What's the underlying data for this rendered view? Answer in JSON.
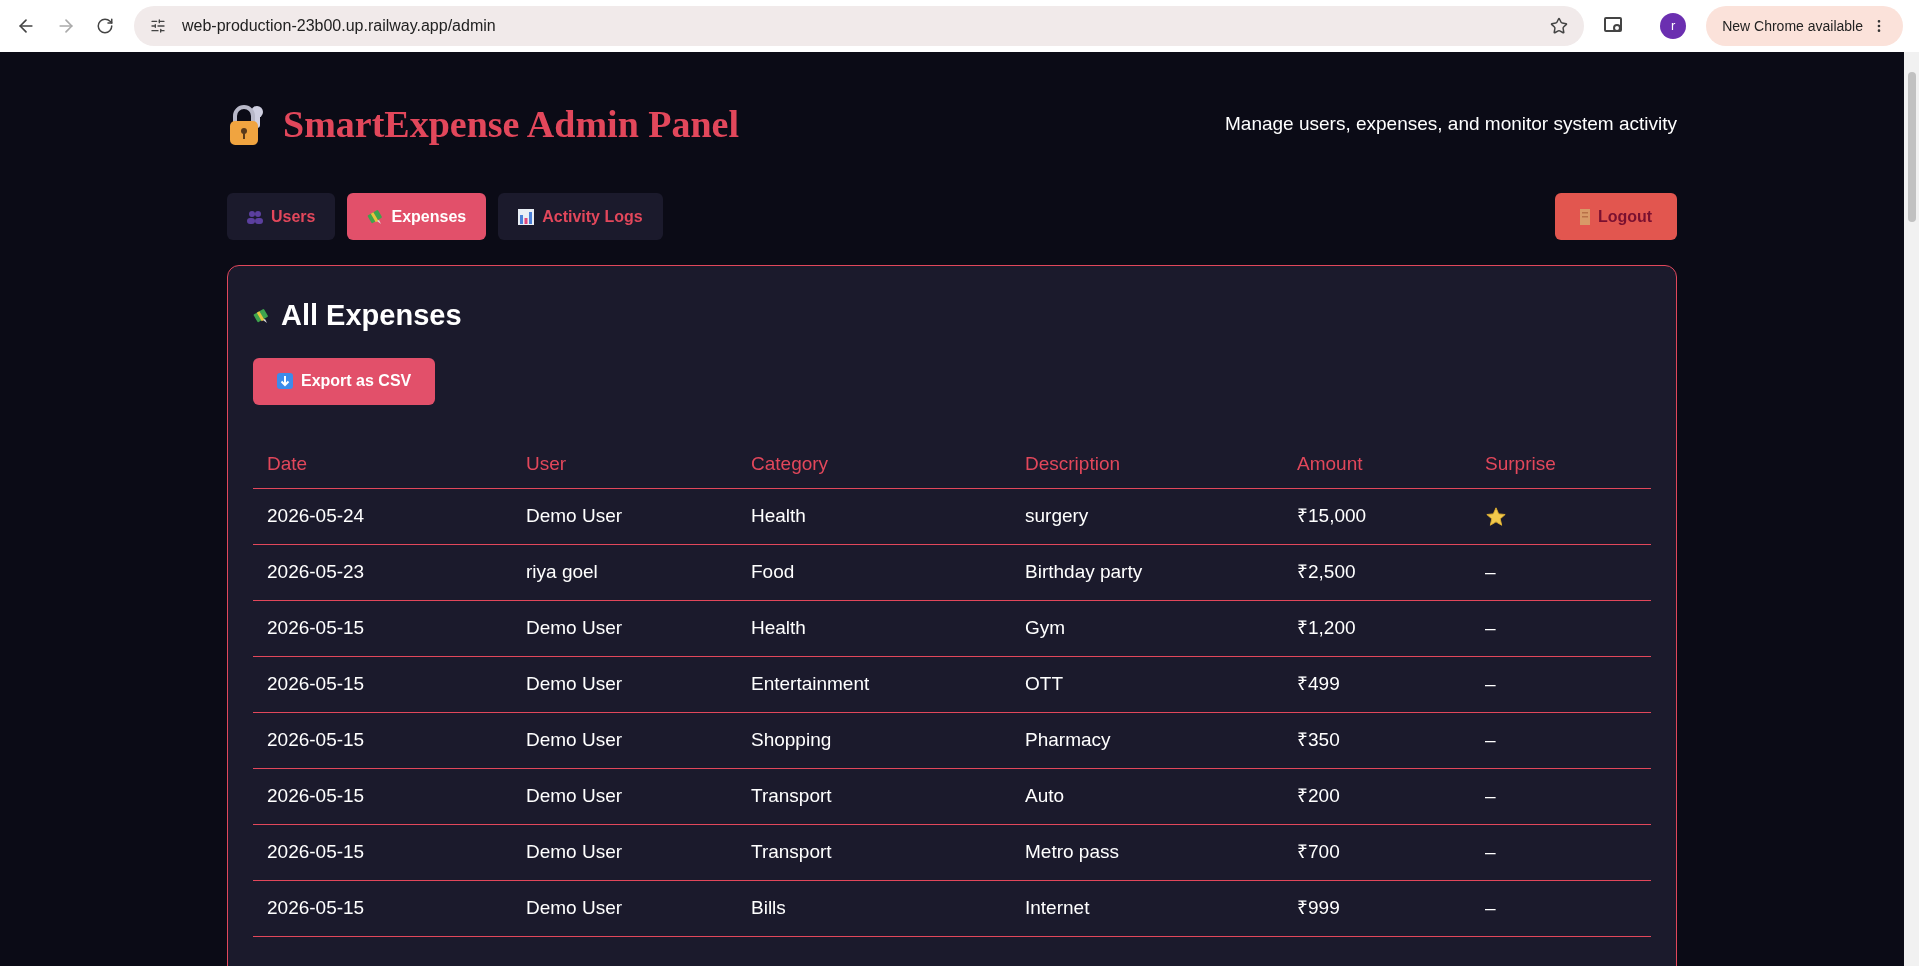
{
  "browser": {
    "url": "web-production-23b00.up.railway.app/admin",
    "profile_initial": "r",
    "update_label": "New Chrome available"
  },
  "header": {
    "title": "SmartExpense Admin Panel",
    "subtitle": "Manage users, expenses, and monitor system activity"
  },
  "tabs": [
    {
      "label": "Users",
      "kind": "users",
      "selected": false
    },
    {
      "label": "Expenses",
      "kind": "money",
      "selected": true
    },
    {
      "label": "Activity Logs",
      "kind": "chart",
      "selected": false
    }
  ],
  "logout": {
    "label": "Logout"
  },
  "panel": {
    "title": "All Expenses",
    "export_label": "Export as CSV"
  },
  "table": {
    "columns": [
      "Date",
      "User",
      "Category",
      "Description",
      "Amount",
      "Surprise"
    ],
    "rows": [
      {
        "date": "2026-05-24",
        "user": "Demo User",
        "category": "Health",
        "description": "surgery",
        "amount": "₹15,000",
        "starred": true
      },
      {
        "date": "2026-05-23",
        "user": "riya goel",
        "category": "Food",
        "description": "Birthday party",
        "amount": "₹2,500",
        "starred": false,
        "surprise": "–"
      },
      {
        "date": "2026-05-15",
        "user": "Demo User",
        "category": "Health",
        "description": "Gym",
        "amount": "₹1,200",
        "starred": false,
        "surprise": "–"
      },
      {
        "date": "2026-05-15",
        "user": "Demo User",
        "category": "Entertainment",
        "description": "OTT",
        "amount": "₹499",
        "starred": false,
        "surprise": "–"
      },
      {
        "date": "2026-05-15",
        "user": "Demo User",
        "category": "Shopping",
        "description": "Pharmacy",
        "amount": "₹350",
        "starred": false,
        "surprise": "–"
      },
      {
        "date": "2026-05-15",
        "user": "Demo User",
        "category": "Transport",
        "description": "Auto",
        "amount": "₹200",
        "starred": false,
        "surprise": "–"
      },
      {
        "date": "2026-05-15",
        "user": "Demo User",
        "category": "Transport",
        "description": "Metro pass",
        "amount": "₹700",
        "starred": false,
        "surprise": "–"
      },
      {
        "date": "2026-05-15",
        "user": "Demo User",
        "category": "Bills",
        "description": "Internet",
        "amount": "₹999",
        "starred": false,
        "surprise": "–"
      }
    ]
  }
}
